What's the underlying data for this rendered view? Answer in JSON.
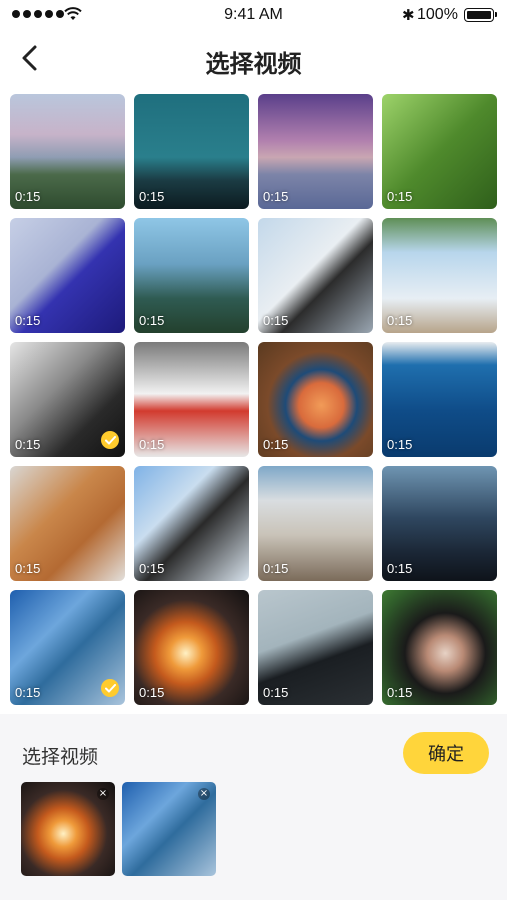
{
  "status_bar": {
    "time": "9:41 AM",
    "battery": "100%"
  },
  "header": {
    "title": "选择视频"
  },
  "videos": [
    {
      "duration": "0:15",
      "selected": false
    },
    {
      "duration": "0:15",
      "selected": false
    },
    {
      "duration": "0:15",
      "selected": false
    },
    {
      "duration": "0:15",
      "selected": false
    },
    {
      "duration": "0:15",
      "selected": false
    },
    {
      "duration": "0:15",
      "selected": false
    },
    {
      "duration": "0:15",
      "selected": false
    },
    {
      "duration": "0:15",
      "selected": false
    },
    {
      "duration": "0:15",
      "selected": true
    },
    {
      "duration": "0:15",
      "selected": false
    },
    {
      "duration": "0:15",
      "selected": false
    },
    {
      "duration": "0:15",
      "selected": false
    },
    {
      "duration": "0:15",
      "selected": false
    },
    {
      "duration": "0:15",
      "selected": false
    },
    {
      "duration": "0:15",
      "selected": false
    },
    {
      "duration": "0:15",
      "selected": false
    },
    {
      "duration": "0:15",
      "selected": true
    },
    {
      "duration": "0:15",
      "selected": false
    },
    {
      "duration": "0:15",
      "selected": false
    },
    {
      "duration": "0:15",
      "selected": false
    }
  ],
  "selection_panel": {
    "title": "选择视频",
    "confirm_label": "确定",
    "remove_glyph": "×"
  },
  "colors": {
    "accent": "#FFD53B",
    "check": "#FFCB2D",
    "panel_bg": "#F6F6F8"
  }
}
